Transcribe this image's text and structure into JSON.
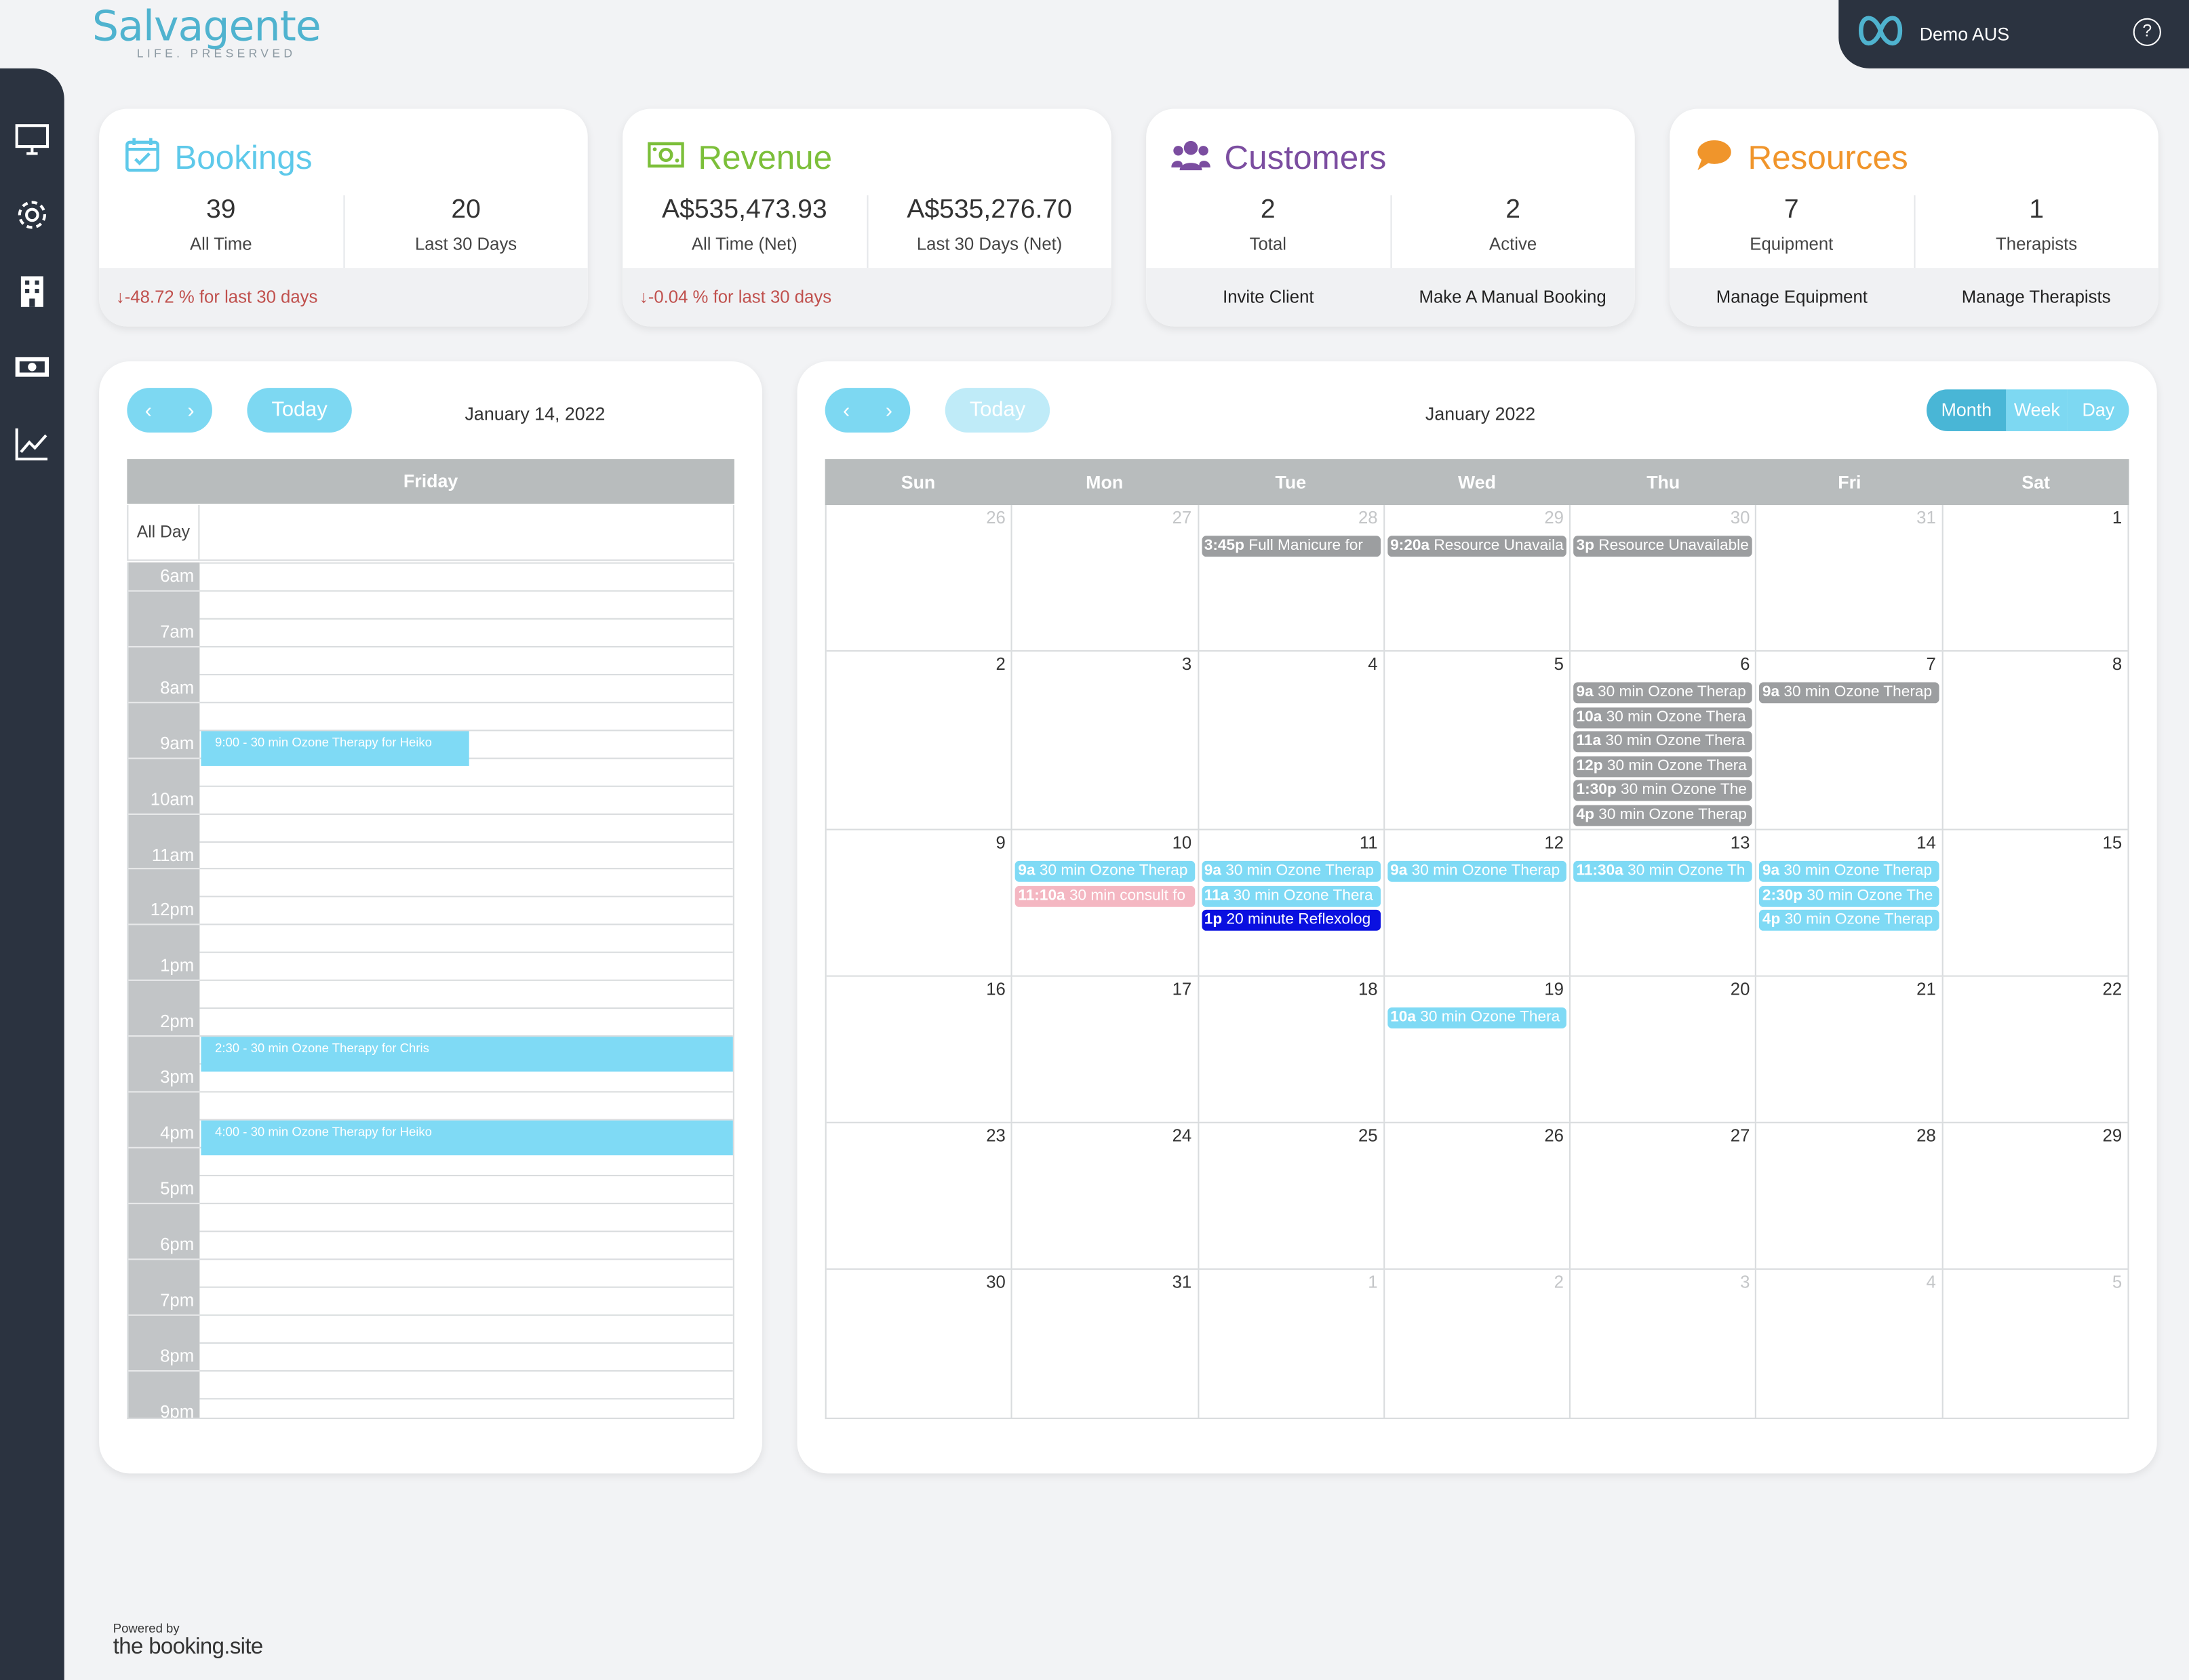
{
  "brand": {
    "logo_text": "Salvagente",
    "logo_sub": "LIFE. PRESERVED"
  },
  "account": {
    "name": "Demo AUS",
    "help": "?"
  },
  "sidebar": [
    "monitor-icon",
    "gear-icon",
    "building-icon",
    "money-icon",
    "trend-chart-icon"
  ],
  "cards": {
    "bookings": {
      "title": "Bookings",
      "color": "#5ec9ea",
      "v1": "39",
      "l1": "All Time",
      "v2": "20",
      "l2": "Last 30 Days",
      "trend": "-48.72 % for last 30 days"
    },
    "revenue": {
      "title": "Revenue",
      "color": "#7cbf3a",
      "v1": "A$535,473.93",
      "l1": "All Time (Net)",
      "v2": "A$535,276.70",
      "l2": "Last 30 Days (Net)",
      "trend": "-0.04 % for last 30 days"
    },
    "customers": {
      "title": "Customers",
      "color": "#7b4da0",
      "v1": "2",
      "l1": "Total",
      "v2": "2",
      "l2": "Active",
      "link1": "Invite Client",
      "link2": "Make A Manual Booking"
    },
    "resources": {
      "title": "Resources",
      "color": "#f0952b",
      "v1": "7",
      "l1": "Equipment",
      "v2": "1",
      "l2": "Therapists",
      "link1": "Manage Equipment",
      "link2": "Manage Therapists"
    }
  },
  "day_view": {
    "today": "Today",
    "date": "January 14, 2022",
    "day": "Friday",
    "all_day": "All Day",
    "hours": [
      "6am",
      "7am",
      "8am",
      "9am",
      "10am",
      "11am",
      "12pm",
      "1pm",
      "2pm",
      "3pm",
      "4pm",
      "5pm",
      "6pm",
      "7pm",
      "8pm",
      "9pm"
    ],
    "events": [
      {
        "text": "9:00 - 30 min Ozone Therapy for Heiko"
      },
      {
        "text": "2:30 - 30 min Ozone Therapy for Chris"
      },
      {
        "text": "4:00 - 30 min Ozone Therapy for Heiko"
      }
    ]
  },
  "month_view": {
    "today": "Today",
    "title": "January 2022",
    "views": [
      "Month",
      "Week",
      "Day"
    ],
    "weekdays": [
      "Sun",
      "Mon",
      "Tue",
      "Wed",
      "Thu",
      "Fri",
      "Sat"
    ],
    "weeks": [
      [
        {
          "d": "26",
          "o": true
        },
        {
          "d": "27",
          "o": true
        },
        {
          "d": "28",
          "o": true,
          "ev": [
            {
              "t": "3:45p",
              "x": "Full Manicure for",
              "c": "gray"
            }
          ]
        },
        {
          "d": "29",
          "o": true,
          "ev": [
            {
              "t": "9:20a",
              "x": "Resource Unavaila",
              "c": "gray"
            }
          ]
        },
        {
          "d": "30",
          "o": true,
          "ev": [
            {
              "t": "3p",
              "x": "Resource Unavailable",
              "c": "gray"
            }
          ]
        },
        {
          "d": "31",
          "o": true
        },
        {
          "d": "1"
        }
      ],
      [
        {
          "d": "2"
        },
        {
          "d": "3"
        },
        {
          "d": "4"
        },
        {
          "d": "5"
        },
        {
          "d": "6",
          "ev": [
            {
              "t": "9a",
              "x": "30 min Ozone Therap",
              "c": "gray"
            },
            {
              "t": "10a",
              "x": "30 min Ozone Thera",
              "c": "gray"
            },
            {
              "t": "11a",
              "x": "30 min Ozone Thera",
              "c": "gray"
            },
            {
              "t": "12p",
              "x": "30 min Ozone Thera",
              "c": "gray"
            },
            {
              "t": "1:30p",
              "x": "30 min Ozone The",
              "c": "gray"
            },
            {
              "t": "4p",
              "x": "30 min Ozone Therap",
              "c": "gray"
            }
          ]
        },
        {
          "d": "7",
          "ev": [
            {
              "t": "9a",
              "x": "30 min Ozone Therap",
              "c": "gray"
            }
          ]
        },
        {
          "d": "8"
        }
      ],
      [
        {
          "d": "9"
        },
        {
          "d": "10",
          "ev": [
            {
              "t": "9a",
              "x": "30 min Ozone Therap",
              "c": "cyan"
            },
            {
              "t": "11:10a",
              "x": "30 min consult fo",
              "c": "pink"
            }
          ]
        },
        {
          "d": "11",
          "ev": [
            {
              "t": "9a",
              "x": "30 min Ozone Therap",
              "c": "cyan"
            },
            {
              "t": "11a",
              "x": "30 min Ozone Thera",
              "c": "cyan"
            },
            {
              "t": "1p",
              "x": "20 minute Reflexolog",
              "c": "blue"
            }
          ]
        },
        {
          "d": "12",
          "ev": [
            {
              "t": "9a",
              "x": "30 min Ozone Therap",
              "c": "cyan"
            }
          ]
        },
        {
          "d": "13",
          "ev": [
            {
              "t": "11:30a",
              "x": "30 min Ozone Th",
              "c": "cyan"
            }
          ]
        },
        {
          "d": "14",
          "ev": [
            {
              "t": "9a",
              "x": "30 min Ozone Therap",
              "c": "cyan"
            },
            {
              "t": "2:30p",
              "x": "30 min Ozone The",
              "c": "cyan"
            },
            {
              "t": "4p",
              "x": "30 min Ozone Therap",
              "c": "cyan"
            }
          ]
        },
        {
          "d": "15"
        }
      ],
      [
        {
          "d": "16"
        },
        {
          "d": "17"
        },
        {
          "d": "18"
        },
        {
          "d": "19",
          "ev": [
            {
              "t": "10a",
              "x": "30 min Ozone Thera",
              "c": "cyan"
            }
          ]
        },
        {
          "d": "20"
        },
        {
          "d": "21"
        },
        {
          "d": "22"
        }
      ],
      [
        {
          "d": "23"
        },
        {
          "d": "24"
        },
        {
          "d": "25"
        },
        {
          "d": "26"
        },
        {
          "d": "27"
        },
        {
          "d": "28"
        },
        {
          "d": "29"
        }
      ],
      [
        {
          "d": "30"
        },
        {
          "d": "31"
        },
        {
          "d": "1",
          "o": true
        },
        {
          "d": "2",
          "o": true
        },
        {
          "d": "3",
          "o": true
        },
        {
          "d": "4",
          "o": true
        },
        {
          "d": "5",
          "o": true
        }
      ]
    ]
  },
  "footer": {
    "powered": "Powered by",
    "brand": "the booking.site"
  }
}
